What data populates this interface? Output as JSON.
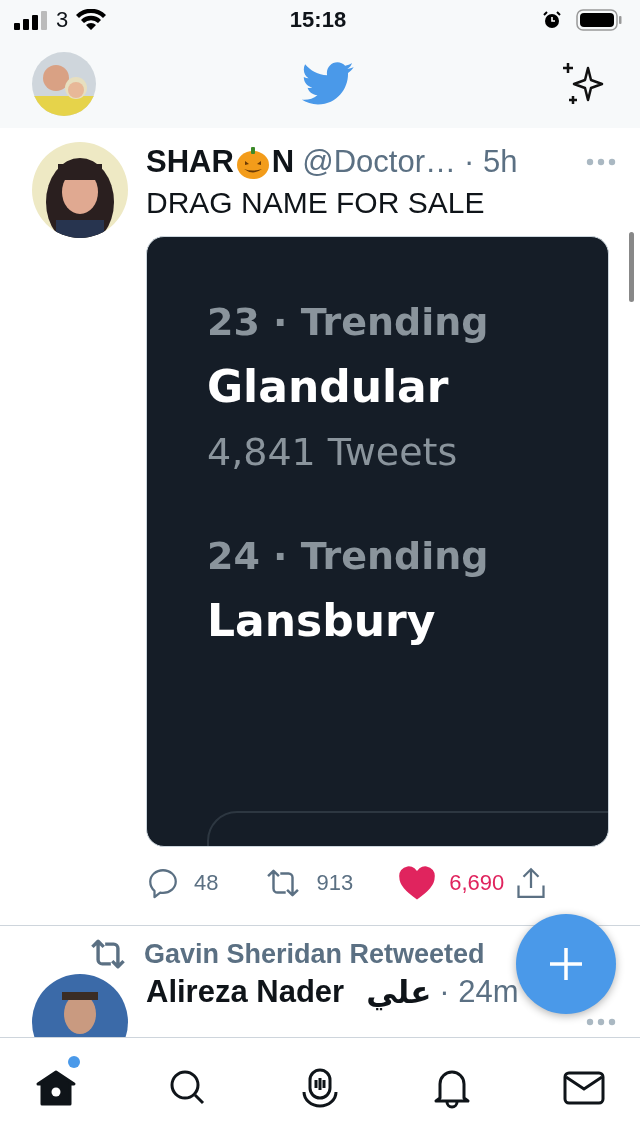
{
  "status_bar": {
    "carrier": "3",
    "time": "15:18"
  },
  "tweets": [
    {
      "kind": "media",
      "name_before": "SHAR",
      "name_after": "N",
      "handle": "@Doctor…",
      "time": "· 5h",
      "text": "DRAG NAME FOR SALE",
      "media": {
        "trends": [
          {
            "rank": "23 · Trending",
            "name": "Glandular",
            "count": "4,841 Tweets"
          },
          {
            "rank": "24 · Trending",
            "name": "Lansbury"
          }
        ]
      },
      "actions": {
        "replies": "48",
        "retweets": "913",
        "likes": "6,690",
        "liked": true
      }
    },
    {
      "kind": "retweet",
      "retweeted_by": "Gavin Sheridan Retweeted",
      "name": "Alireza Nader",
      "arabic": "علي",
      "time": "· 24m"
    }
  ],
  "tabs": [
    {
      "kind": "home",
      "selected": true,
      "badge": true
    },
    {
      "kind": "search",
      "selected": false
    },
    {
      "kind": "spaces",
      "selected": false
    },
    {
      "kind": "notifications",
      "selected": false
    },
    {
      "kind": "messages",
      "selected": false
    }
  ]
}
